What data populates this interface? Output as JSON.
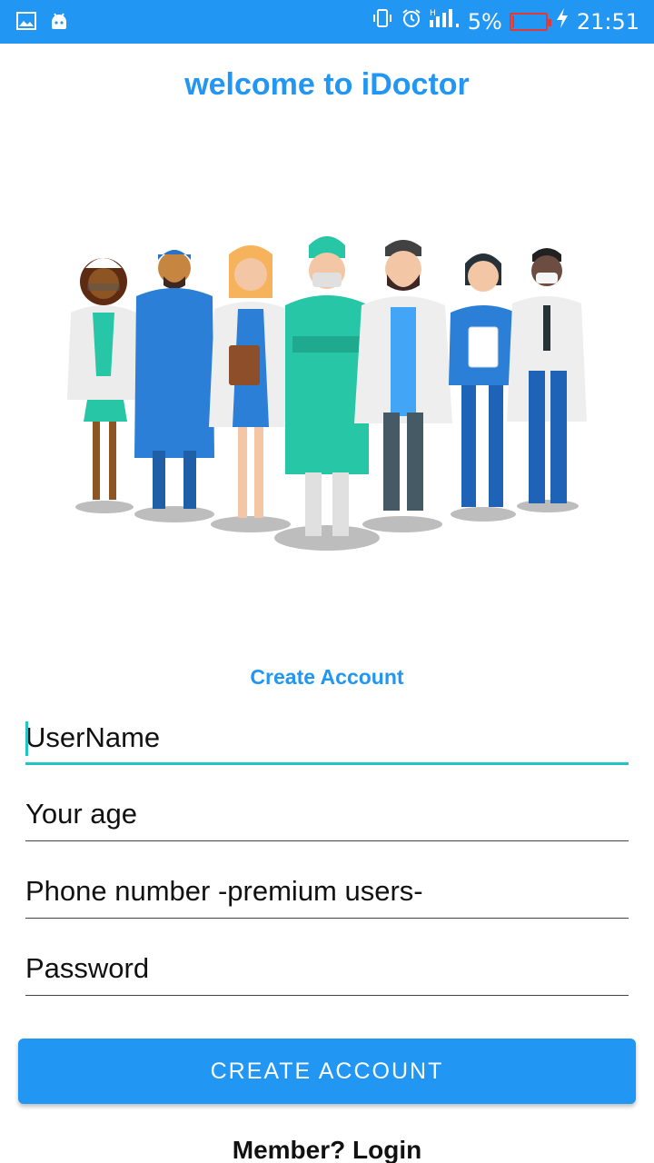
{
  "status_bar": {
    "battery_percent": "5%",
    "battery_level": 0.05,
    "time": "21:51",
    "icons": [
      "image-icon",
      "android-icon",
      "vibrate-icon",
      "alarm-icon",
      "signal-icon",
      "battery-icon",
      "charging-icon"
    ]
  },
  "header": {
    "title": "welcome to iDoctor"
  },
  "illustration": {
    "icon": "doctors-group-illustration"
  },
  "form": {
    "heading": "Create Account",
    "username_placeholder": "UserName",
    "age_placeholder": "Your age",
    "phone_placeholder": "Phone number -premium users-",
    "password_placeholder": "Password",
    "submit_label": "CREATE ACCOUNT",
    "login_link": "Member? Login"
  },
  "colors": {
    "primary": "#2196f3",
    "accent": "#20c4c6",
    "battery_low": "#e53935"
  }
}
